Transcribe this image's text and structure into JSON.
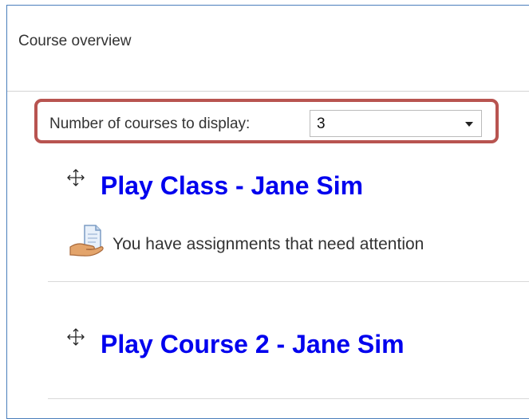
{
  "block": {
    "title": "Course overview"
  },
  "selector": {
    "label": "Number of courses to display:",
    "value": "3"
  },
  "courses": [
    {
      "name": "Play Class - Jane Sim",
      "notice": "You have assignments that need attention"
    },
    {
      "name": "Play Course 2 - Jane Sim"
    }
  ],
  "colors": {
    "link": "#0000ee",
    "highlight_border": "#b85450",
    "block_border": "#4a7ebb"
  }
}
